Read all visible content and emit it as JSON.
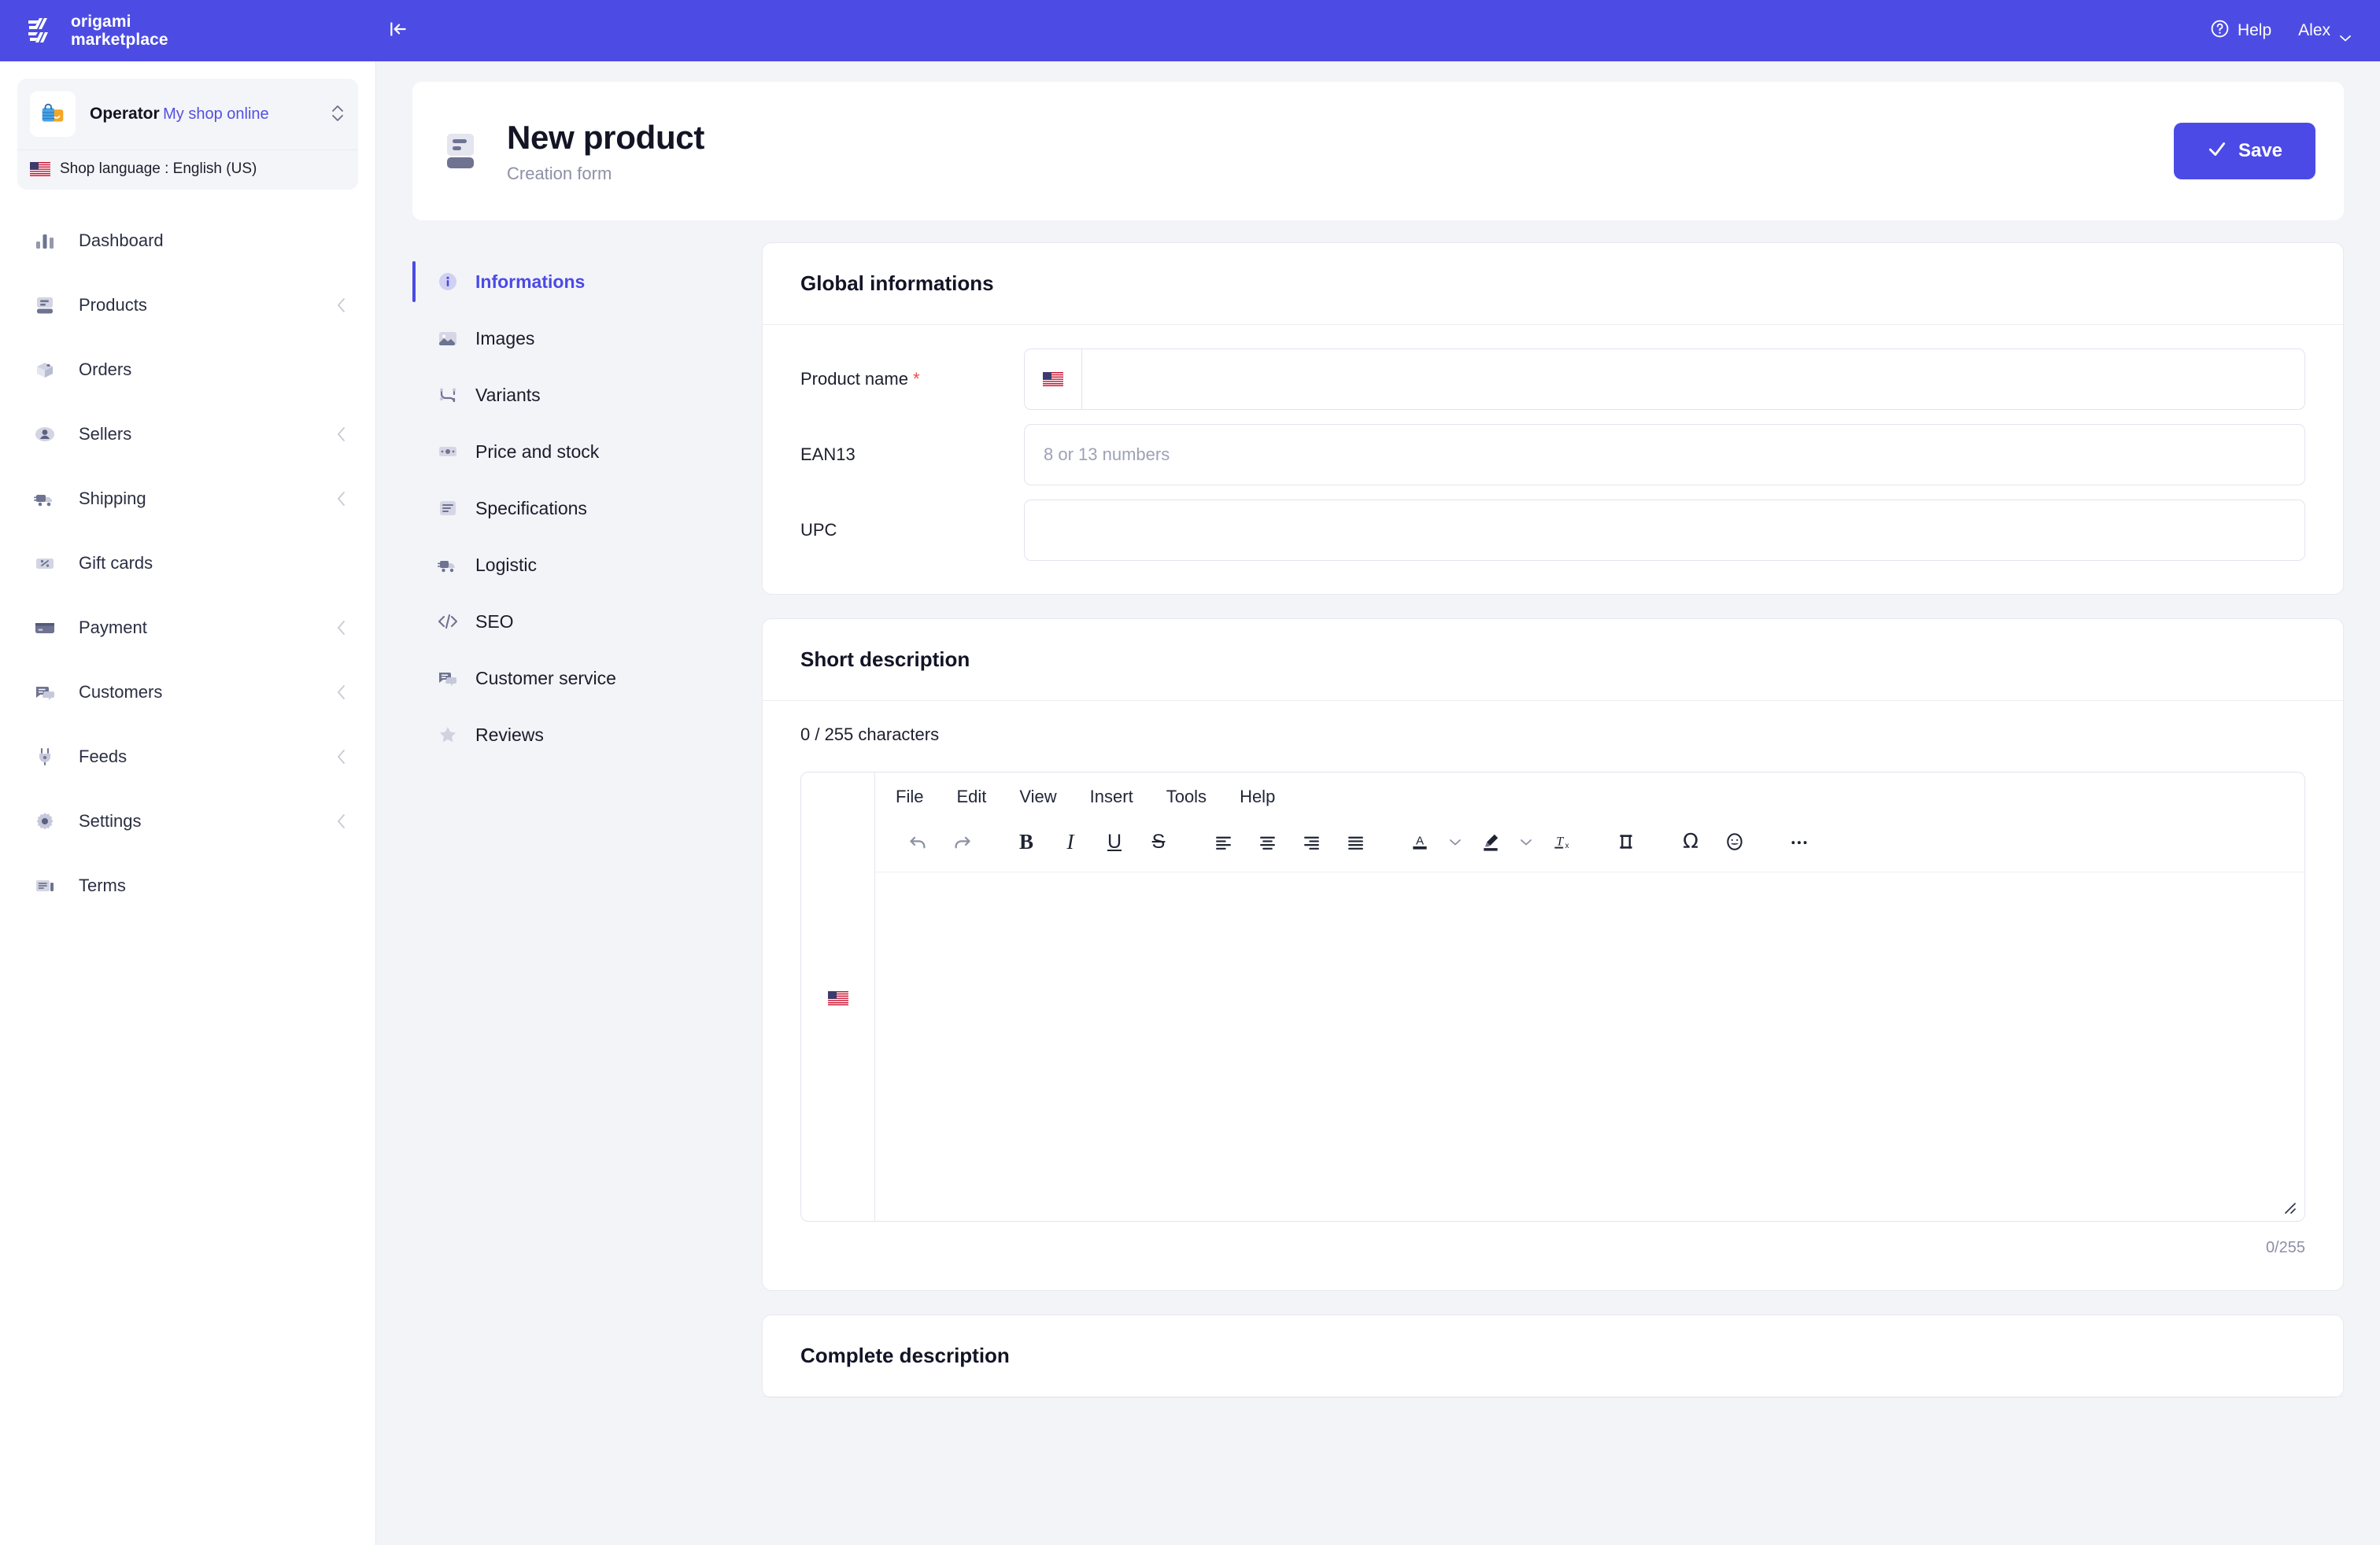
{
  "brand": {
    "name_line1": "origami",
    "name_line2": "marketplace",
    "accent": "#4b4ae6",
    "topbar_bg": "#4c4ce4"
  },
  "topbar": {
    "collapse_icon": "collapse-sidebar-icon",
    "help_label": "Help",
    "help_icon": "question-circle-icon",
    "user_label": "Alex",
    "user_chevron_icon": "chevron-down-icon"
  },
  "sidebar": {
    "shop": {
      "name": "Operator",
      "subtitle": "My shop online",
      "logo_icon": "shopping-bag-icon",
      "switch_icon": "chevron-up-down-icon",
      "language_label": "Shop language : English (US)",
      "language_flag_icon": "flag-us-icon"
    },
    "items": [
      {
        "label": "Dashboard",
        "icon": "bar-chart-icon",
        "expandable": false
      },
      {
        "label": "Products",
        "icon": "products-icon",
        "expandable": true
      },
      {
        "label": "Orders",
        "icon": "box-icon",
        "expandable": false
      },
      {
        "label": "Sellers",
        "icon": "user-circle-icon",
        "expandable": true
      },
      {
        "label": "Shipping",
        "icon": "truck-icon",
        "expandable": true
      },
      {
        "label": "Gift cards",
        "icon": "percent-card-icon",
        "expandable": false
      },
      {
        "label": "Payment",
        "icon": "credit-card-icon",
        "expandable": true
      },
      {
        "label": "Customers",
        "icon": "chat-bubble-icon",
        "expandable": true
      },
      {
        "label": "Feeds",
        "icon": "plug-icon",
        "expandable": true
      },
      {
        "label": "Settings",
        "icon": "gear-icon",
        "expandable": true
      },
      {
        "label": "Terms",
        "icon": "document-icon",
        "expandable": false
      }
    ]
  },
  "page": {
    "icon": "product-card-icon",
    "title": "New product",
    "subtitle": "Creation form",
    "save_label": "Save",
    "save_icon": "check-icon"
  },
  "tabs": [
    {
      "label": "Informations",
      "icon": "info-circle-icon",
      "active": true
    },
    {
      "label": "Images",
      "icon": "image-icon",
      "active": false
    },
    {
      "label": "Variants",
      "icon": "variants-icon",
      "active": false
    },
    {
      "label": "Price and stock",
      "icon": "price-tag-icon",
      "active": false
    },
    {
      "label": "Specifications",
      "icon": "list-lines-icon",
      "active": false
    },
    {
      "label": "Logistic",
      "icon": "truck-icon",
      "active": false
    },
    {
      "label": "SEO",
      "icon": "code-icon",
      "active": false
    },
    {
      "label": "Customer service",
      "icon": "chat-bubble-icon",
      "active": false
    },
    {
      "label": "Reviews",
      "icon": "star-icon",
      "active": false
    }
  ],
  "global_informations": {
    "title": "Global informations",
    "fields": {
      "product_name": {
        "label": "Product name",
        "required_marker": "*",
        "value": "",
        "placeholder": "",
        "flag_icon": "flag-us-icon"
      },
      "ean13": {
        "label": "EAN13",
        "value": "",
        "placeholder": "8 or 13 numbers"
      },
      "upc": {
        "label": "UPC",
        "value": "",
        "placeholder": ""
      }
    }
  },
  "short_description": {
    "title": "Short description",
    "char_counter": "0 / 255 characters",
    "bottom_counter": "0/255",
    "flag_icon": "flag-us-icon",
    "editor": {
      "menubar": [
        "File",
        "Edit",
        "View",
        "Insert",
        "Tools",
        "Help"
      ],
      "toolbar": [
        {
          "name": "undo-icon"
        },
        {
          "name": "redo-icon"
        },
        {
          "name": "bold-icon",
          "glyph": "B"
        },
        {
          "name": "italic-icon",
          "glyph": "I"
        },
        {
          "name": "underline-icon",
          "glyph": "U"
        },
        {
          "name": "strikethrough-icon",
          "glyph": "S"
        },
        {
          "name": "align-left-icon"
        },
        {
          "name": "align-center-icon"
        },
        {
          "name": "align-right-icon"
        },
        {
          "name": "align-justify-icon"
        },
        {
          "name": "text-color-icon",
          "glyph": "A"
        },
        {
          "name": "text-color-chevron-down-icon"
        },
        {
          "name": "highlight-color-icon"
        },
        {
          "name": "highlight-color-chevron-down-icon"
        },
        {
          "name": "clear-formatting-icon"
        },
        {
          "name": "horizontal-rule-icon"
        },
        {
          "name": "special-character-icon",
          "glyph": "Ω"
        },
        {
          "name": "emoji-icon"
        },
        {
          "name": "more-options-icon"
        }
      ],
      "content": "",
      "resize_handle_icon": "resize-grip-icon"
    }
  },
  "complete_description": {
    "title": "Complete description"
  }
}
